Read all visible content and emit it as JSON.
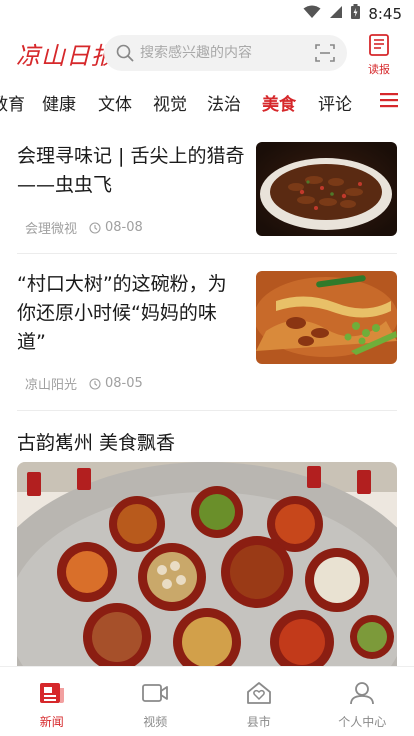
{
  "status_bar": {
    "time": "8:45"
  },
  "header": {
    "logo_text": "凉山日报",
    "search_placeholder": "搜索感兴趣的内容",
    "read_label": "读报"
  },
  "tabs": [
    {
      "label": "教育",
      "active": false
    },
    {
      "label": "健康",
      "active": false
    },
    {
      "label": "文体",
      "active": false
    },
    {
      "label": "视觉",
      "active": false
    },
    {
      "label": "法治",
      "active": false
    },
    {
      "label": "美食",
      "active": true
    },
    {
      "label": "评论",
      "active": false
    }
  ],
  "news": [
    {
      "title": "会理寻味记 | 舌尖上的猎奇——虫虫飞",
      "source": "会理微视",
      "date": "08-08",
      "image": "dish-of-fried-insects"
    },
    {
      "title": "“村口大树”的这碗粉，为你还原小时候“妈妈的味道”",
      "source": "凉山阳光",
      "date": "08-05",
      "image": "bowl-of-noodles-with-scallions"
    }
  ],
  "featured": {
    "title": "古韵嶲州 美食飘香",
    "image": "banquet-table-of-dishes"
  },
  "bottom_nav": [
    {
      "label": "新闻",
      "icon": "news-icon",
      "active": true
    },
    {
      "label": "视频",
      "icon": "video-icon",
      "active": false
    },
    {
      "label": "县市",
      "icon": "county-icon",
      "active": false
    },
    {
      "label": "个人中心",
      "icon": "user-icon",
      "active": false
    }
  ],
  "colors": {
    "accent": "#d6282b",
    "meta": "#a0a0a0"
  }
}
